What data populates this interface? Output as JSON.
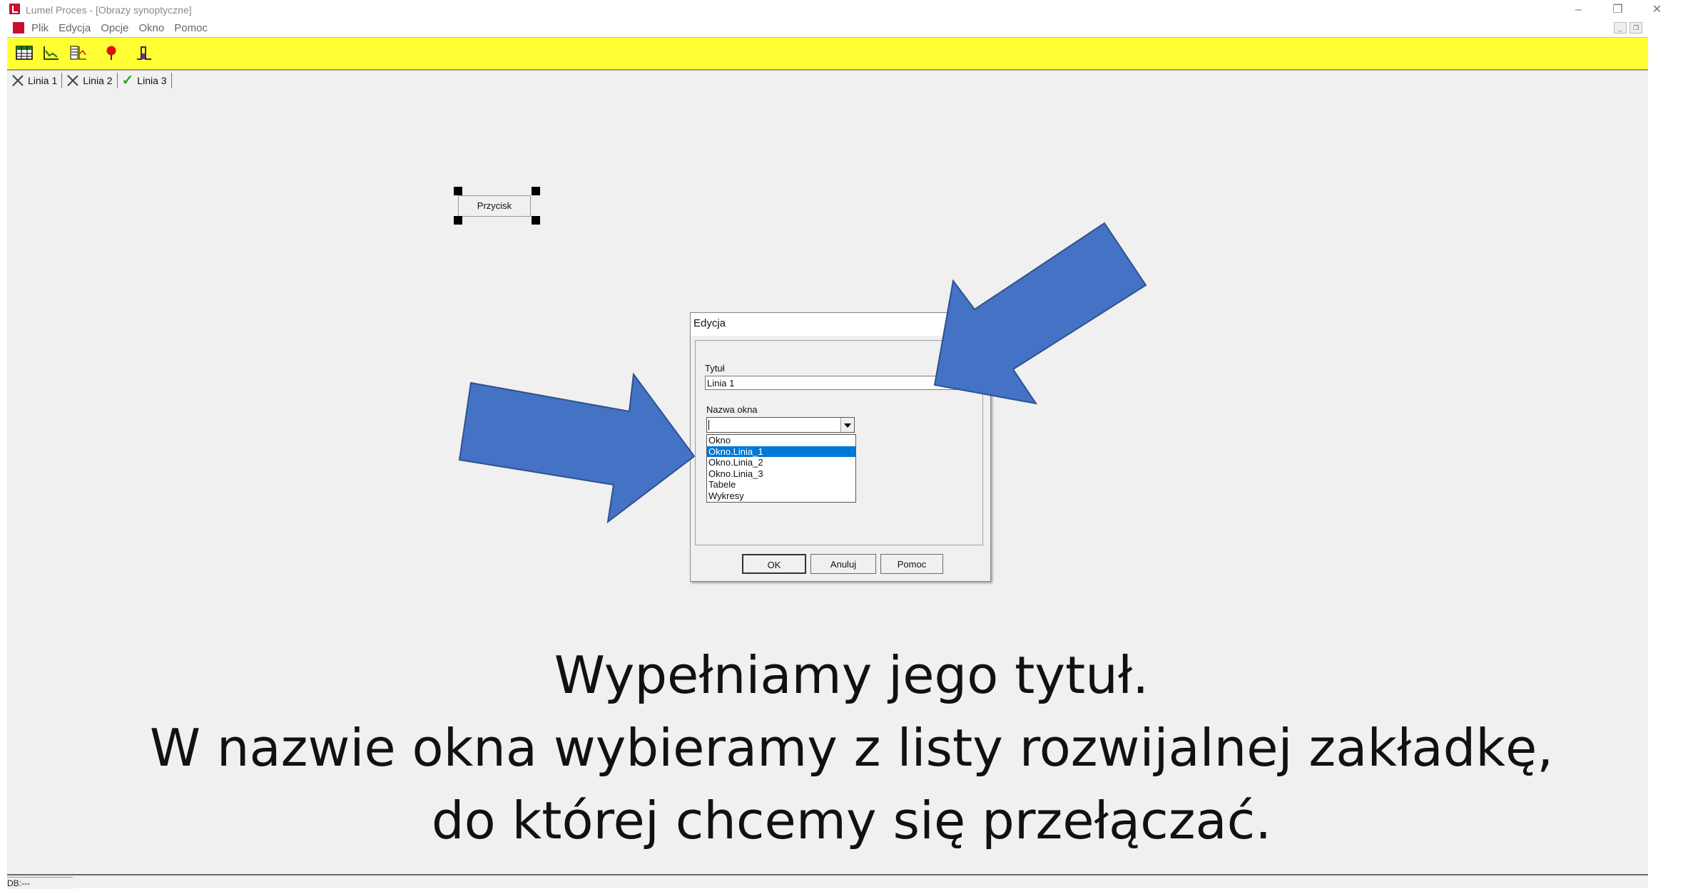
{
  "window": {
    "title": "Lumel Proces - [Obrazy synoptyczne]",
    "controls": [
      "–",
      "❐",
      "✕"
    ]
  },
  "menu": {
    "items": [
      "Plik",
      "Edycja",
      "Opcje",
      "Okno",
      "Pomoc"
    ]
  },
  "toolbar": {
    "icons": [
      "table-icon",
      "chart-icon",
      "list-chart-icon",
      "pushpin-icon",
      "signal-icon"
    ]
  },
  "tabs": [
    {
      "label": "Linia 1",
      "state": "x"
    },
    {
      "label": "Linia 2",
      "state": "x"
    },
    {
      "label": "Linia 3",
      "state": "check"
    }
  ],
  "canvas": {
    "button_label": "Przycisk"
  },
  "dialog": {
    "title": "Edycja",
    "title_label": "Tytuł",
    "title_value": "Linia 1",
    "window_name_label": "Nazwa okna",
    "dropdown_options": [
      "Okno",
      "Okno.Linia_1",
      "Okno.Linia_2",
      "Okno.Linia_3",
      "Tabele",
      "Wykresy"
    ],
    "selected_option": "Okno.Linia_1",
    "ok_label": "OK",
    "cancel_label": "Anuluj",
    "help_label": "Pomoc"
  },
  "caption": {
    "line1": "Wypełniamy jego tytuł.",
    "line2": "W nazwie okna wybieramy z listy rozwijalnej zakładkę,",
    "line3": "do której chcemy się przełączać."
  },
  "status": {
    "text": "DB:---"
  },
  "colors": {
    "toolbar": "#ffff33",
    "arrow": "#4472c4",
    "selection": "#0078d7",
    "check": "#2fa52f"
  }
}
